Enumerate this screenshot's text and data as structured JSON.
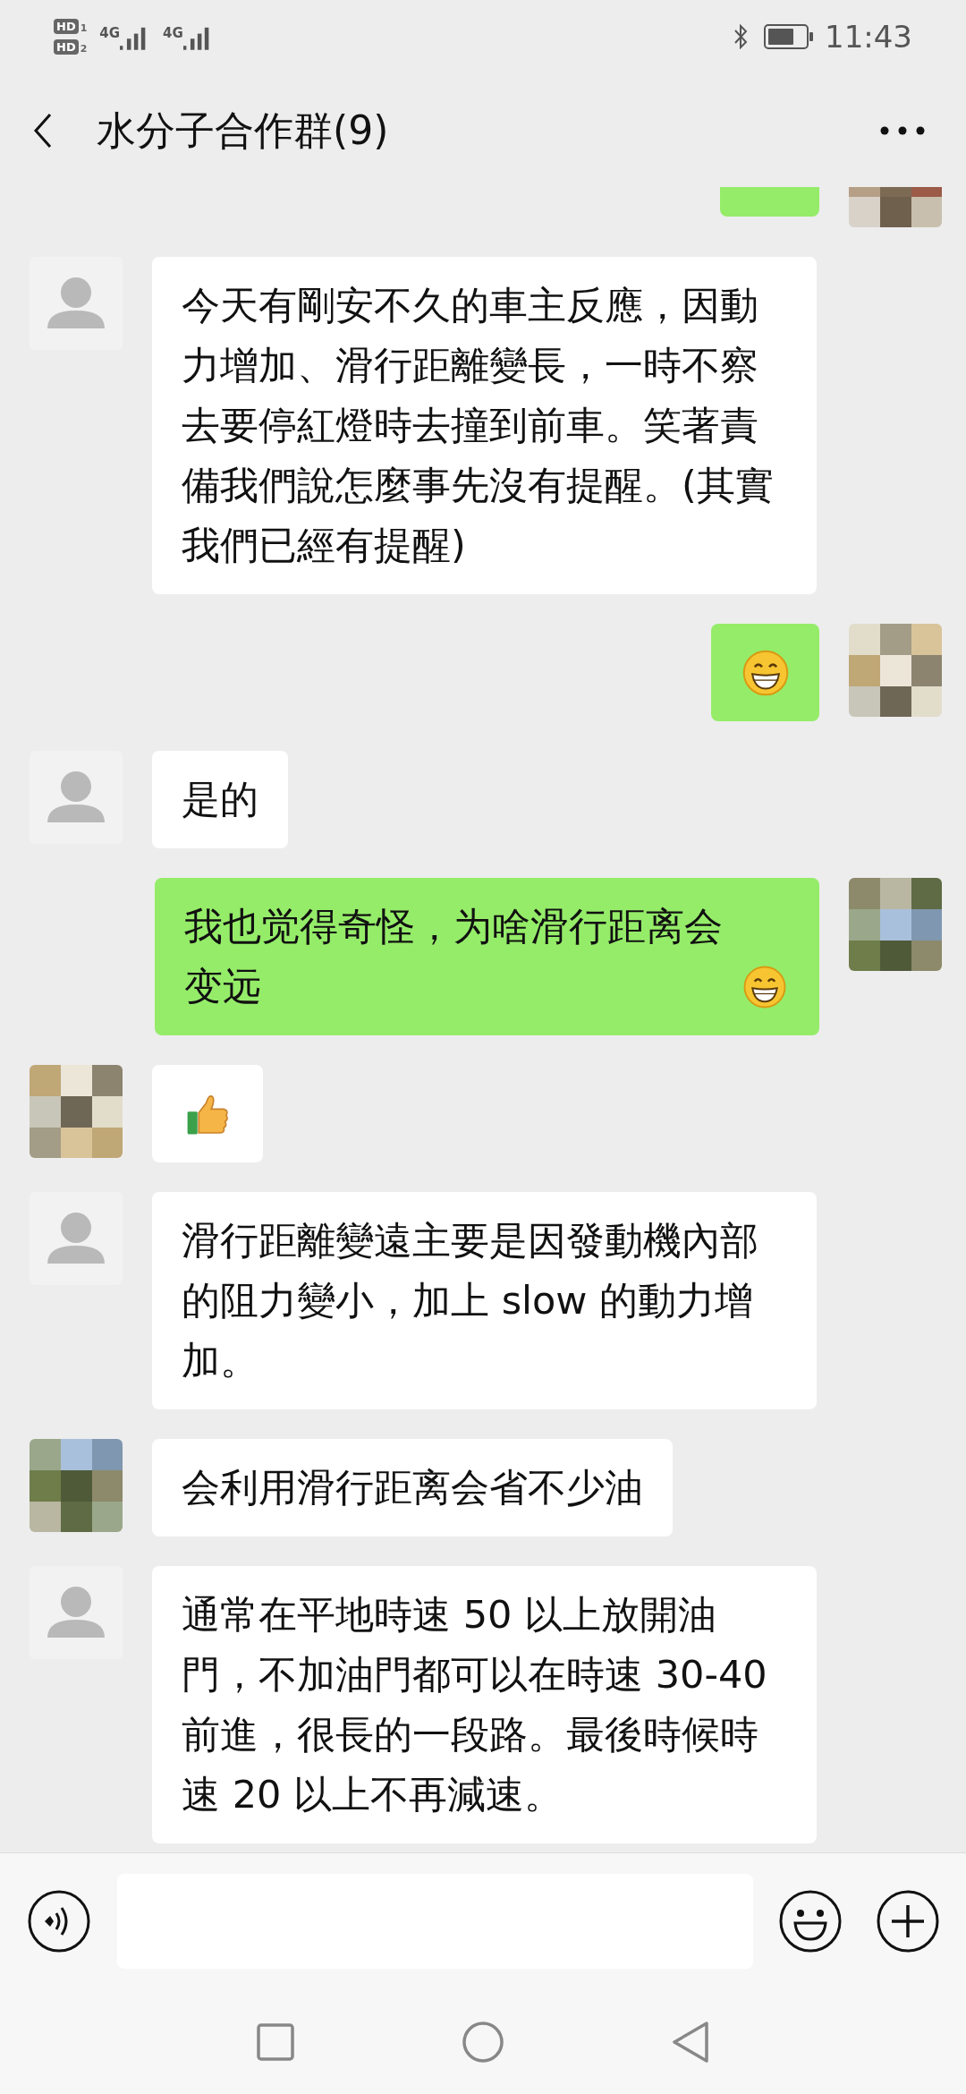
{
  "status_bar": {
    "sims": [
      {
        "label": "HD",
        "slot": "1"
      },
      {
        "label": "HD",
        "slot": "2"
      }
    ],
    "networks": [
      "4G",
      "4G"
    ],
    "time": "11:43"
  },
  "header": {
    "title": "水分子合作群(9)"
  },
  "messages": [
    {
      "outgoing": true,
      "avatar_photo": true,
      "kind": "partial"
    },
    {
      "outgoing": false,
      "avatar_photo": false,
      "kind": "text",
      "text": "今天有剛安不久的車主反應，因動力增加、滑行距離變長，一時不察去要停紅燈時去撞到前車。笑著責備我們說怎麼事先沒有提醒。(其實我們已經有提醒)"
    },
    {
      "outgoing": true,
      "avatar_photo": true,
      "kind": "grin"
    },
    {
      "outgoing": false,
      "avatar_photo": false,
      "kind": "text",
      "text": "是的"
    },
    {
      "outgoing": true,
      "avatar_photo": true,
      "kind": "text-grin",
      "text": "我也觉得奇怪，为啥滑行距离会变远"
    },
    {
      "outgoing": false,
      "avatar_photo": true,
      "kind": "thumbs"
    },
    {
      "outgoing": false,
      "avatar_photo": false,
      "kind": "text",
      "text": "滑行距離變遠主要是因發動機內部的阻力變小，加上 slow 的動力增加。"
    },
    {
      "outgoing": false,
      "avatar_photo": true,
      "kind": "text",
      "text": "会利用滑行距离会省不少油"
    },
    {
      "outgoing": false,
      "avatar_photo": false,
      "kind": "text",
      "text": "通常在平地時速 50 以上放開油門，不加油門都可以在時速 30-40 前進，很長的一段路。最後時候時速 20 以上不再減速。"
    }
  ]
}
